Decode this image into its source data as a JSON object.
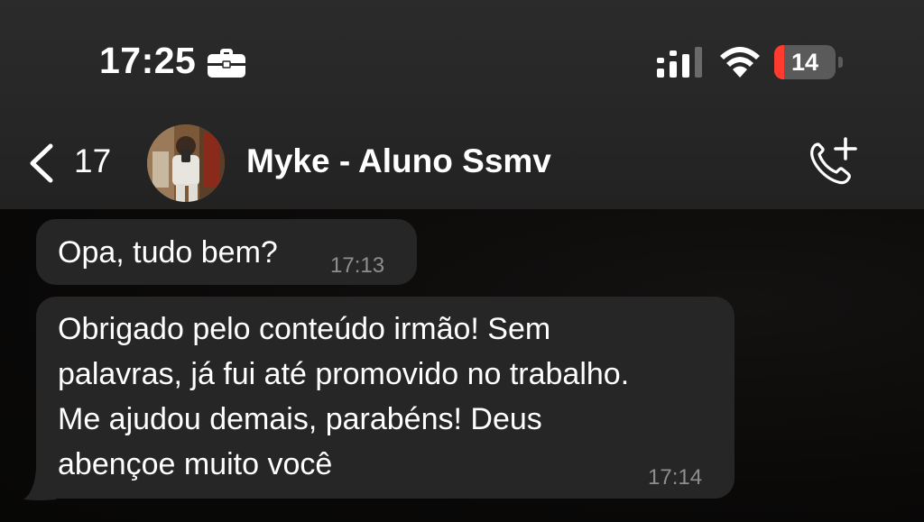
{
  "status_bar": {
    "time": "17:25",
    "battery_level": "14",
    "icons": [
      "briefcase-icon",
      "signal-icon",
      "wifi-icon",
      "battery-icon"
    ],
    "battery_color": "#ff3b30"
  },
  "header": {
    "back_count": "17",
    "contact_name": "Myke - Aluno Ssmv",
    "icons": [
      "chevron-left-icon",
      "avatar",
      "phone-add-icon"
    ]
  },
  "messages": [
    {
      "text": "Opa, tudo bem?",
      "time": "17:13"
    },
    {
      "text": "Obrigado pelo conteúdo irmão! Sem\npalavras, já fui até promovido no trabalho.\nMe ajudou demais, parabéns! Deus\nabençoe muito você",
      "time": "17:14"
    }
  ],
  "colors": {
    "header_bg": "#262626",
    "chat_bg": "#0b0a09",
    "bubble_bg": "#262626",
    "timestamp": "#8e8e8e"
  }
}
